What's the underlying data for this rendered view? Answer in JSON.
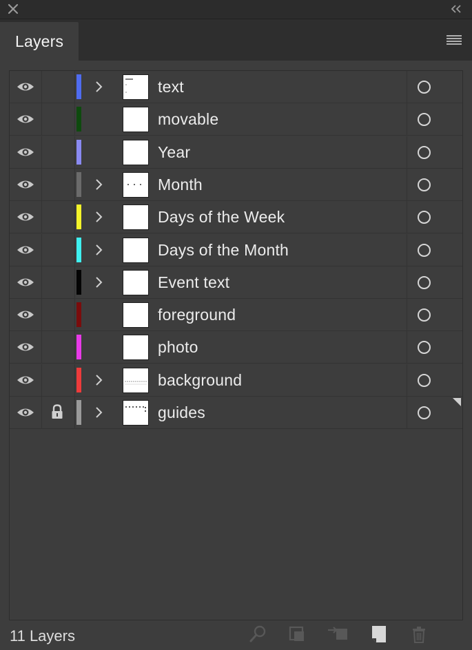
{
  "panel": {
    "tab_label": "Layers",
    "footer_count": "11 Layers"
  },
  "layers": [
    {
      "name": "text",
      "color": "#4f6cf0",
      "expandable": true,
      "locked": false,
      "thumb": "text"
    },
    {
      "name": "movable",
      "color": "#0e4a0e",
      "expandable": false,
      "locked": false,
      "thumb": "blank"
    },
    {
      "name": "Year",
      "color": "#8a8af2",
      "expandable": false,
      "locked": false,
      "thumb": "blank"
    },
    {
      "name": "Month",
      "color": "#6b6b6b",
      "expandable": true,
      "locked": false,
      "thumb": "dashes"
    },
    {
      "name": "Days of the Week",
      "color": "#f4f42a",
      "expandable": true,
      "locked": false,
      "thumb": "blank"
    },
    {
      "name": "Days of the Month",
      "color": "#3ff0f0",
      "expandable": true,
      "locked": false,
      "thumb": "blank"
    },
    {
      "name": "Event text",
      "color": "#050505",
      "expandable": true,
      "locked": false,
      "thumb": "blank"
    },
    {
      "name": "foreground",
      "color": "#7a0c0c",
      "expandable": false,
      "locked": false,
      "thumb": "blank"
    },
    {
      "name": "photo",
      "color": "#e83ae8",
      "expandable": false,
      "locked": false,
      "thumb": "blank"
    },
    {
      "name": "background",
      "color": "#ee3b3b",
      "expandable": true,
      "locked": false,
      "thumb": "lines"
    },
    {
      "name": "guides",
      "color": "#9a9a9a",
      "expandable": true,
      "locked": true,
      "thumb": "guides"
    }
  ],
  "icons": {
    "close": "close-icon",
    "collapse": "double-chevron-left-icon",
    "panel_menu": "hamburger-menu-icon",
    "visibility": "eye-icon",
    "lock": "lock-icon",
    "expand": "chevron-right-icon",
    "target": "target-circle-icon",
    "footer": [
      "search-icon",
      "clipping-mask-icon",
      "move-to-layer-icon",
      "new-layer-icon",
      "trash-icon"
    ]
  }
}
